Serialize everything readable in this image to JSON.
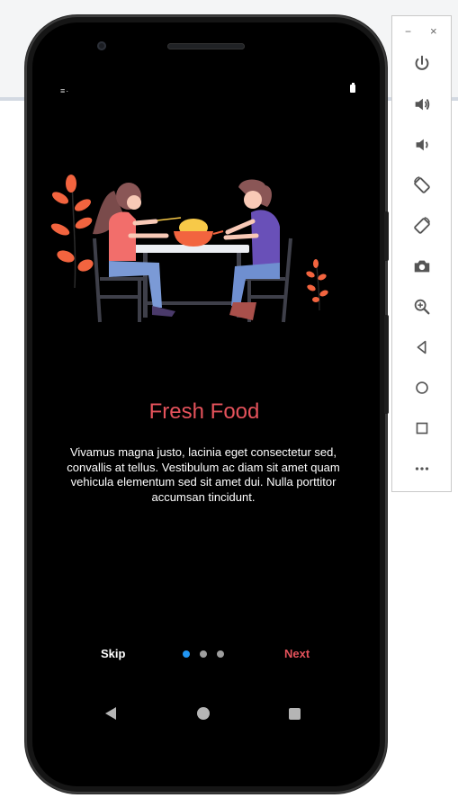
{
  "screen": {
    "title": "Fresh Food",
    "description": "Vivamus magna justo, lacinia eget consectetur sed, convallis at tellus. Vestibulum ac diam sit amet quam vehicula elementum sed sit amet dui. Nulla porttitor accumsan tincidunt.",
    "skip_label": "Skip",
    "next_label": "Next",
    "page_indicator": {
      "current": 1,
      "total": 3
    }
  },
  "status_bar": {
    "left_text": "≡·"
  },
  "colors": {
    "accent": "#e4525b",
    "active_dot": "#2196f3",
    "inactive_dot": "#9e9e9e",
    "screen_bg": "#000000"
  },
  "emulator_toolbar": {
    "minimize_label": "−",
    "close_label": "×",
    "buttons": [
      "power-icon",
      "volume-up-icon",
      "volume-down-icon",
      "rotate-left-icon",
      "rotate-right-icon",
      "camera-icon",
      "zoom-icon",
      "back-icon",
      "home-icon",
      "overview-icon",
      "more-icon"
    ]
  }
}
